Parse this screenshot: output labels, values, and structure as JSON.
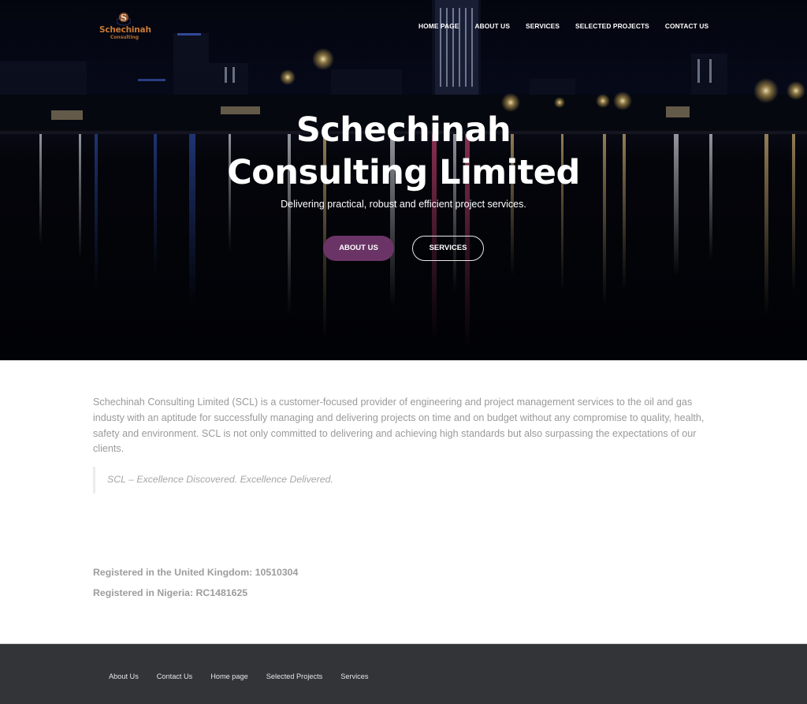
{
  "brand": {
    "logo_name": "Schechinah",
    "logo_sub": "Consulting",
    "logo_initial": "S",
    "accent_color": "#6b3466",
    "logo_color": "#c97a34"
  },
  "nav": {
    "items": [
      {
        "label": "HOME PAGE"
      },
      {
        "label": "ABOUT US"
      },
      {
        "label": "SERVICES"
      },
      {
        "label": "SELECTED PROJECTS"
      },
      {
        "label": "CONTACT US"
      }
    ]
  },
  "hero": {
    "title_line1": "Schechinah",
    "title_line2": "Consulting Limited",
    "subtitle": "Delivering practical, robust and efficient project services.",
    "primary_button": "ABOUT US",
    "secondary_button": "SERVICES"
  },
  "content": {
    "intro": "Schechinah Consulting Limited (SCL) is a customer-focused provider of engineering and project management services to the oil and gas industy with an aptitude for successfully managing and delivering projects on time and on budget without any compromise to quality, health, safety and environment. SCL is not only committed to delivering and achieving high standards but also surpassing the expectations of our clients.",
    "quote": "SCL – Excellence Discovered.  Excellence Delivered.",
    "registration_uk": "Registered in the United Kingdom: 10510304",
    "registration_ng": "Registered in Nigeria: RC1481625"
  },
  "footer": {
    "links": [
      {
        "label": "About Us"
      },
      {
        "label": "Contact Us"
      },
      {
        "label": "Home page"
      },
      {
        "label": "Selected Projects"
      },
      {
        "label": "Services"
      }
    ]
  }
}
